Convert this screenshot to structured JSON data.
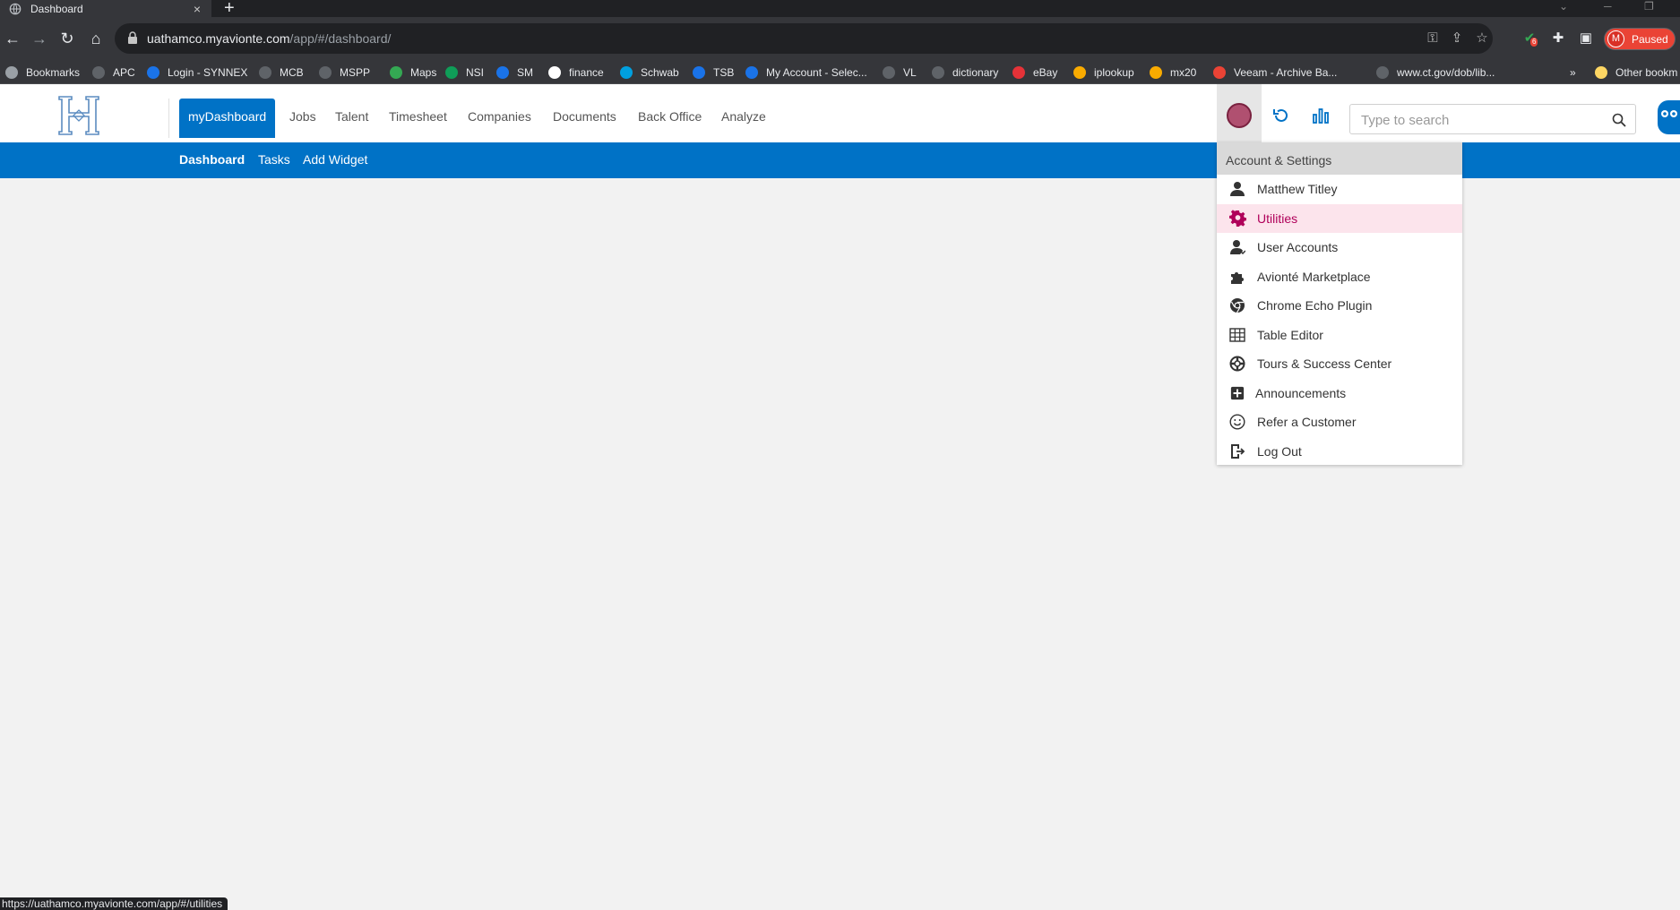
{
  "browser": {
    "tab_title": "Dashboard",
    "tab_close": "×",
    "new_tab": "+",
    "url_host": "uathamco.myavionte.com",
    "url_path": "/app/#/dashboard/",
    "profile_initial": "M",
    "profile_status": "Paused",
    "extension_badge": "6",
    "bookmarks_overflow": "»",
    "bookmarks": [
      {
        "label": "Bookmarks",
        "color": "#9aa0a6"
      },
      {
        "label": "APC",
        "color": "#5f6368"
      },
      {
        "label": "Login - SYNNEX",
        "color": "#1a73e8"
      },
      {
        "label": "MCB",
        "color": "#5f6368"
      },
      {
        "label": "MSPP",
        "color": "#5f6368"
      },
      {
        "label": "Maps",
        "color": "#34a853"
      },
      {
        "label": "NSI",
        "color": "#0f9d58"
      },
      {
        "label": "SM",
        "color": "#1a73e8"
      },
      {
        "label": "finance",
        "color": "#ffffff"
      },
      {
        "label": "Schwab",
        "color": "#00a0df"
      },
      {
        "label": "TSB",
        "color": "#1a73e8"
      },
      {
        "label": "My Account - Selec...",
        "color": "#1a73e8"
      },
      {
        "label": "VL",
        "color": "#5f6368"
      },
      {
        "label": "dictionary",
        "color": "#5f6368"
      },
      {
        "label": "eBay",
        "color": "#e53238"
      },
      {
        "label": "iplookup",
        "color": "#f9ab00"
      },
      {
        "label": "mx20",
        "color": "#f9ab00"
      },
      {
        "label": "Veeam - Archive Ba...",
        "color": "#ea4335"
      },
      {
        "label": "www.ct.gov/dob/lib...",
        "color": "#5f6368"
      },
      {
        "label": "Other bookm",
        "color": "#fdd663"
      }
    ],
    "status_url": "https://uathamco.myavionte.com/app/#/utilities"
  },
  "app": {
    "nav": [
      "myDashboard",
      "Jobs",
      "Talent",
      "Timesheet",
      "Companies",
      "Documents",
      "Back Office",
      "Analyze"
    ],
    "subnav": [
      "Dashboard",
      "Tasks",
      "Add Widget"
    ],
    "search_placeholder": "Type to search",
    "accent_color": "#0072c6",
    "dropdown": {
      "header": "Account & Settings",
      "items": [
        {
          "label": "Matthew Titley",
          "icon": "user-icon"
        },
        {
          "label": "Utilities",
          "icon": "gear-icon"
        },
        {
          "label": "User Accounts",
          "icon": "user-accounts-icon"
        },
        {
          "label": "Avionté Marketplace",
          "icon": "puzzle-icon"
        },
        {
          "label": "Chrome Echo Plugin",
          "icon": "chrome-icon"
        },
        {
          "label": "Table Editor",
          "icon": "table-icon"
        },
        {
          "label": "Tours & Success Center",
          "icon": "lifebuoy-icon"
        },
        {
          "label": "Announcements",
          "icon": "plus-square-icon"
        },
        {
          "label": "Refer a Customer",
          "icon": "smiley-icon"
        },
        {
          "label": "Log Out",
          "icon": "logout-icon"
        }
      ]
    }
  }
}
